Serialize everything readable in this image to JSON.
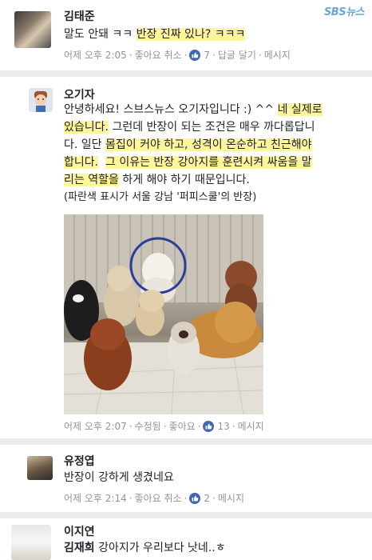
{
  "watermark": "SBS뉴스",
  "comments": [
    {
      "author": "김태준",
      "text_plain": "말도 안돼 ㅋㅋ ",
      "text_highlight": "반장 진짜 있나? ㅋㅋㅋ",
      "time": "어제 오후 2:05",
      "like_action": "좋아요 취소",
      "like_count": "7",
      "reply": "답글 달기",
      "message": "메시지"
    },
    {
      "author": "오기자",
      "lines": [
        {
          "plain": "안녕하세요! 스브스뉴스 오기자입니다 :) ^^ ",
          "highlight": "네 실제로"
        },
        {
          "plain": "",
          "highlight": "있습니다.",
          "tail": " 그런데 반장이 되는 조건은 매우 까다롭답니"
        },
        {
          "plain": "다. 일단 ",
          "highlight": "몸집이 커야 하고, 성격이 온순하고 친근해야"
        },
        {
          "plain": "",
          "highlight": "합니다.",
          "tail": "  ",
          "highlight2": "그 이유는 반장 강아지를 훈련시켜 싸움을 말"
        },
        {
          "plain": "",
          "highlight": "리는 역할을",
          "tail": " 하게 해야 하기 때문입니다."
        },
        {
          "plain": "(파란색 표시가 서울 강남 '퍼피스쿨'의 반장)"
        }
      ],
      "time": "어제 오후 2:07",
      "edited": "수정됨",
      "like_action": "좋아요",
      "like_count": "13",
      "message": "메시지"
    },
    {
      "author": "유정엽",
      "text": "반장이 강하게 생겼네요",
      "time": "어제 오후 2:14",
      "like_action": "좋아요 취소",
      "like_count": "2",
      "message": "메시지"
    },
    {
      "author": "이지연",
      "mention": "김재희",
      "text": " 강아지가 우리보다 낫네..ㅎ"
    }
  ],
  "colors": {
    "highlight": "#fff59d",
    "meta": "#90949c",
    "like_blue": "#4267b2",
    "circle": "#2c3e9a"
  }
}
